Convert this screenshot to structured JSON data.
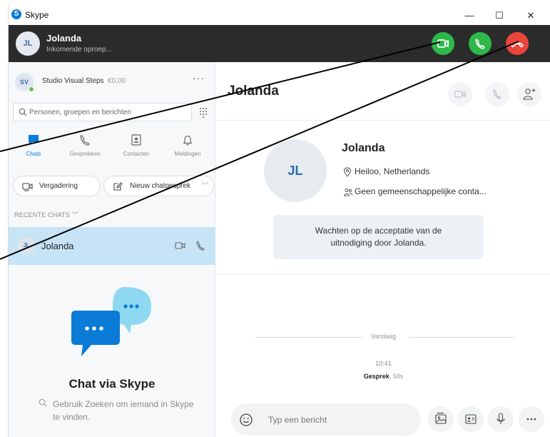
{
  "window": {
    "app_title": "Skype",
    "app_icon_letter": "S",
    "controls": {
      "minimize": "—",
      "maximize": "☐",
      "close": "✕"
    }
  },
  "incoming_call": {
    "avatar_initials": "JL",
    "caller_name": "Jolanda",
    "status": "Inkomende oproep...",
    "buttons": [
      "video-accept",
      "audio-accept",
      "decline"
    ],
    "colors": {
      "accept": "#2fb84a",
      "decline": "#e9453b",
      "bar": "#2b2b2b"
    }
  },
  "sidebar": {
    "profile": {
      "initials": "SV",
      "name": "Studio Visual Steps",
      "credit": "€0,00",
      "more": "···"
    },
    "search": {
      "placeholder": "Personen, groepen en berichten"
    },
    "nav_tabs": [
      {
        "label": "Chats",
        "icon": "chat-icon",
        "active": true
      },
      {
        "label": "Gesprekken",
        "icon": "phone-icon",
        "active": false
      },
      {
        "label": "Contacten",
        "icon": "contacts-icon",
        "active": false
      },
      {
        "label": "Meldingen",
        "icon": "bell-icon",
        "active": false
      }
    ],
    "actions": {
      "meeting": "Vergadering",
      "new_chat": "Nieuw chatgesprek",
      "new_chat_chevron": "﹀"
    },
    "recent_header": "RECENTE CHATS ﹀",
    "recent_chats": [
      {
        "initials": "JL",
        "name": "Jolanda"
      }
    ],
    "empty_state": {
      "title": "Chat via Skype",
      "description": "Gebruik Zoeken om iemand in Skype te vinden."
    },
    "accent": "#0a7bd6",
    "selected_row_color": "#c6e4f6"
  },
  "conversation": {
    "title": "Jolanda",
    "contact": {
      "initials": "JL",
      "name": "Jolanda",
      "location": "Heiloo, Netherlands",
      "mutual_contacts": "Geen gemeenschappelijke conta..."
    },
    "notice": {
      "line1": "Wachten op de acceptatie van de",
      "line2": "uitnodiging door Jolanda."
    },
    "day_label": "Vandaag",
    "message": {
      "time": "10:41",
      "type": "Gesprek",
      "duration": ", 58s"
    },
    "composer": {
      "placeholder": "Typ een bericht"
    }
  }
}
